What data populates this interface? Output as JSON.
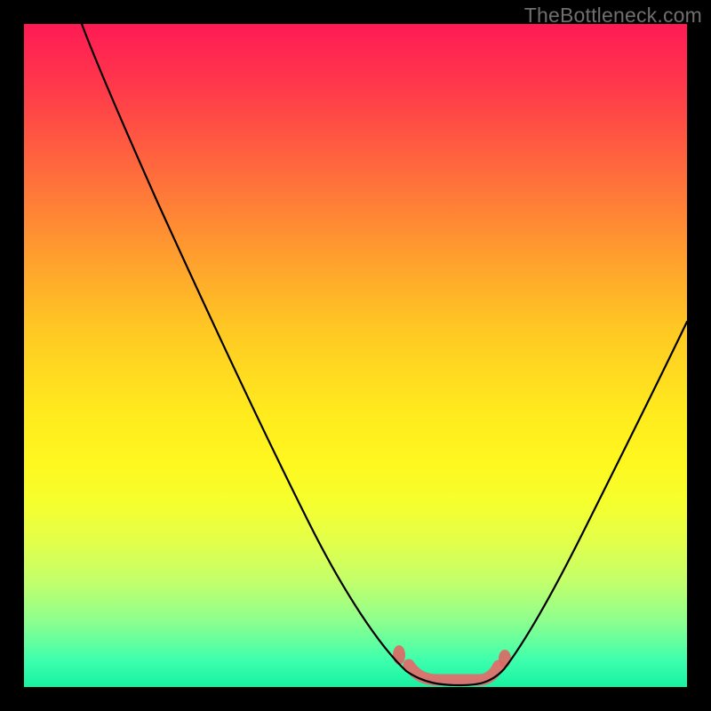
{
  "watermark": "TheBottleneck.com",
  "colors": {
    "background": "#000000",
    "accent_marker": "#e06664",
    "curve": "#000000"
  },
  "chart_data": {
    "type": "line",
    "title": "",
    "xlabel": "",
    "ylabel": "",
    "xlim": [
      0,
      100
    ],
    "ylim": [
      0,
      100
    ],
    "x": [
      0,
      5,
      10,
      15,
      20,
      25,
      30,
      35,
      40,
      45,
      50,
      55,
      58,
      60,
      62,
      64,
      66,
      68,
      70,
      75,
      80,
      85,
      90,
      95,
      100
    ],
    "values": [
      100,
      90,
      80,
      70,
      60,
      51,
      42,
      33,
      25,
      17,
      10,
      4,
      1,
      0,
      0,
      0,
      0,
      0,
      1,
      5,
      12,
      21,
      31,
      42,
      55
    ],
    "flat_minimum_range_x": [
      58,
      70
    ],
    "note": "Values are percentage heights read from the curve; 0 = bottom (green), 100 = top (red). The salmon marker highlights the curve's flat minimum around x≈58–70."
  }
}
